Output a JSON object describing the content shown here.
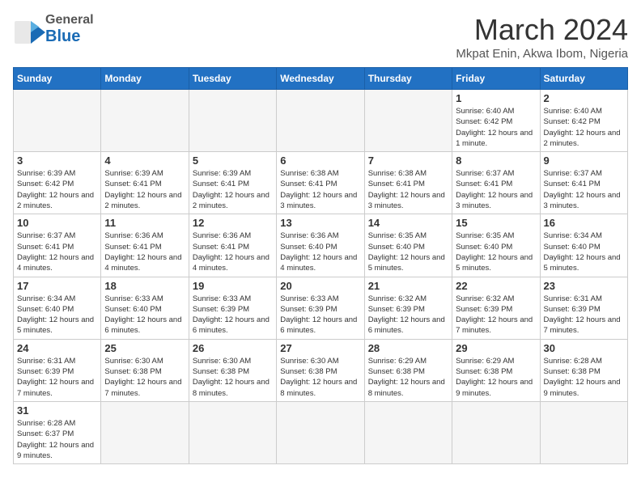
{
  "header": {
    "logo_general": "General",
    "logo_blue": "Blue",
    "month_title": "March 2024",
    "subtitle": "Mkpat Enin, Akwa Ibom, Nigeria"
  },
  "weekdays": [
    "Sunday",
    "Monday",
    "Tuesday",
    "Wednesday",
    "Thursday",
    "Friday",
    "Saturday"
  ],
  "weeks": [
    [
      {
        "day": "",
        "empty": true
      },
      {
        "day": "",
        "empty": true
      },
      {
        "day": "",
        "empty": true
      },
      {
        "day": "",
        "empty": true
      },
      {
        "day": "",
        "empty": true
      },
      {
        "day": "1",
        "sunrise": "6:40 AM",
        "sunset": "6:42 PM",
        "daylight": "12 hours and 1 minute."
      },
      {
        "day": "2",
        "sunrise": "6:40 AM",
        "sunset": "6:42 PM",
        "daylight": "12 hours and 2 minutes."
      }
    ],
    [
      {
        "day": "3",
        "sunrise": "6:39 AM",
        "sunset": "6:42 PM",
        "daylight": "12 hours and 2 minutes."
      },
      {
        "day": "4",
        "sunrise": "6:39 AM",
        "sunset": "6:41 PM",
        "daylight": "12 hours and 2 minutes."
      },
      {
        "day": "5",
        "sunrise": "6:39 AM",
        "sunset": "6:41 PM",
        "daylight": "12 hours and 2 minutes."
      },
      {
        "day": "6",
        "sunrise": "6:38 AM",
        "sunset": "6:41 PM",
        "daylight": "12 hours and 3 minutes."
      },
      {
        "day": "7",
        "sunrise": "6:38 AM",
        "sunset": "6:41 PM",
        "daylight": "12 hours and 3 minutes."
      },
      {
        "day": "8",
        "sunrise": "6:37 AM",
        "sunset": "6:41 PM",
        "daylight": "12 hours and 3 minutes."
      },
      {
        "day": "9",
        "sunrise": "6:37 AM",
        "sunset": "6:41 PM",
        "daylight": "12 hours and 3 minutes."
      }
    ],
    [
      {
        "day": "10",
        "sunrise": "6:37 AM",
        "sunset": "6:41 PM",
        "daylight": "12 hours and 4 minutes."
      },
      {
        "day": "11",
        "sunrise": "6:36 AM",
        "sunset": "6:41 PM",
        "daylight": "12 hours and 4 minutes."
      },
      {
        "day": "12",
        "sunrise": "6:36 AM",
        "sunset": "6:41 PM",
        "daylight": "12 hours and 4 minutes."
      },
      {
        "day": "13",
        "sunrise": "6:36 AM",
        "sunset": "6:40 PM",
        "daylight": "12 hours and 4 minutes."
      },
      {
        "day": "14",
        "sunrise": "6:35 AM",
        "sunset": "6:40 PM",
        "daylight": "12 hours and 5 minutes."
      },
      {
        "day": "15",
        "sunrise": "6:35 AM",
        "sunset": "6:40 PM",
        "daylight": "12 hours and 5 minutes."
      },
      {
        "day": "16",
        "sunrise": "6:34 AM",
        "sunset": "6:40 PM",
        "daylight": "12 hours and 5 minutes."
      }
    ],
    [
      {
        "day": "17",
        "sunrise": "6:34 AM",
        "sunset": "6:40 PM",
        "daylight": "12 hours and 5 minutes."
      },
      {
        "day": "18",
        "sunrise": "6:33 AM",
        "sunset": "6:40 PM",
        "daylight": "12 hours and 6 minutes."
      },
      {
        "day": "19",
        "sunrise": "6:33 AM",
        "sunset": "6:39 PM",
        "daylight": "12 hours and 6 minutes."
      },
      {
        "day": "20",
        "sunrise": "6:33 AM",
        "sunset": "6:39 PM",
        "daylight": "12 hours and 6 minutes."
      },
      {
        "day": "21",
        "sunrise": "6:32 AM",
        "sunset": "6:39 PM",
        "daylight": "12 hours and 6 minutes."
      },
      {
        "day": "22",
        "sunrise": "6:32 AM",
        "sunset": "6:39 PM",
        "daylight": "12 hours and 7 minutes."
      },
      {
        "day": "23",
        "sunrise": "6:31 AM",
        "sunset": "6:39 PM",
        "daylight": "12 hours and 7 minutes."
      }
    ],
    [
      {
        "day": "24",
        "sunrise": "6:31 AM",
        "sunset": "6:39 PM",
        "daylight": "12 hours and 7 minutes."
      },
      {
        "day": "25",
        "sunrise": "6:30 AM",
        "sunset": "6:38 PM",
        "daylight": "12 hours and 7 minutes."
      },
      {
        "day": "26",
        "sunrise": "6:30 AM",
        "sunset": "6:38 PM",
        "daylight": "12 hours and 8 minutes."
      },
      {
        "day": "27",
        "sunrise": "6:30 AM",
        "sunset": "6:38 PM",
        "daylight": "12 hours and 8 minutes."
      },
      {
        "day": "28",
        "sunrise": "6:29 AM",
        "sunset": "6:38 PM",
        "daylight": "12 hours and 8 minutes."
      },
      {
        "day": "29",
        "sunrise": "6:29 AM",
        "sunset": "6:38 PM",
        "daylight": "12 hours and 9 minutes."
      },
      {
        "day": "30",
        "sunrise": "6:28 AM",
        "sunset": "6:38 PM",
        "daylight": "12 hours and 9 minutes."
      }
    ],
    [
      {
        "day": "31",
        "sunrise": "6:28 AM",
        "sunset": "6:37 PM",
        "daylight": "12 hours and 9 minutes."
      },
      {
        "day": "",
        "empty": true
      },
      {
        "day": "",
        "empty": true
      },
      {
        "day": "",
        "empty": true
      },
      {
        "day": "",
        "empty": true
      },
      {
        "day": "",
        "empty": true
      },
      {
        "day": "",
        "empty": true
      }
    ]
  ]
}
